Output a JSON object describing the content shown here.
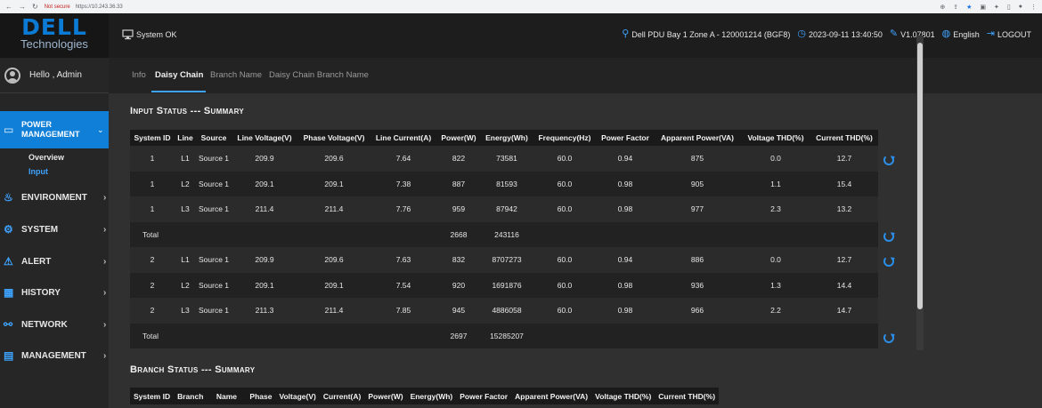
{
  "browser": {
    "secure_label": "Not secure",
    "url": "https://10.243.36.33"
  },
  "header": {
    "logo_top": "DELL",
    "logo_bottom": "Technologies",
    "system_status": "System OK",
    "pdu_name": "Dell PDU Bay 1 Zone A - 120001214 (BGF8)",
    "datetime": "2023-09-11 13:40:50",
    "version": "V1.07801",
    "language": "English",
    "logout": "LOGOUT"
  },
  "sidebar": {
    "greeting": "Hello , Admin",
    "active": {
      "label": "POWER MANAGEMENT",
      "sub": [
        "Overview",
        "Input"
      ]
    },
    "items": [
      "ENVIRONMENT",
      "SYSTEM",
      "ALERT",
      "HISTORY",
      "NETWORK",
      "MANAGEMENT"
    ]
  },
  "tabs": [
    "Info",
    "Daisy Chain",
    "Branch Name",
    "Daisy Chain Branch Name"
  ],
  "input_status": {
    "title": "Input Status --- Summary",
    "columns": [
      "System ID",
      "Line",
      "Source",
      "Line Voltage(V)",
      "Phase Voltage(V)",
      "Line Current(A)",
      "Power(W)",
      "Energy(Wh)",
      "Frequency(Hz)",
      "Power Factor",
      "Apparent Power(VA)",
      "Voltage THD(%)",
      "Current THD(%)"
    ],
    "rows": [
      [
        "1",
        "L1",
        "Source 1",
        "209.9",
        "209.6",
        "7.64",
        "822",
        "73581",
        "60.0",
        "0.94",
        "875",
        "0.0",
        "12.7"
      ],
      [
        "1",
        "L2",
        "Source 1",
        "209.1",
        "209.1",
        "7.38",
        "887",
        "81593",
        "60.0",
        "0.98",
        "905",
        "1.1",
        "15.4"
      ],
      [
        "1",
        "L3",
        "Source 1",
        "211.4",
        "211.4",
        "7.76",
        "959",
        "87942",
        "60.0",
        "0.98",
        "977",
        "2.3",
        "13.2"
      ],
      [
        "Total",
        "",
        "",
        "",
        "",
        "",
        "2668",
        "243116",
        "",
        "",
        "",
        "",
        ""
      ],
      [
        "2",
        "L1",
        "Source 1",
        "209.9",
        "209.6",
        "7.63",
        "832",
        "8707273",
        "60.0",
        "0.94",
        "886",
        "0.0",
        "12.7"
      ],
      [
        "2",
        "L2",
        "Source 1",
        "209.1",
        "209.1",
        "7.54",
        "920",
        "1691876",
        "60.0",
        "0.98",
        "936",
        "1.3",
        "14.4"
      ],
      [
        "2",
        "L3",
        "Source 1",
        "211.3",
        "211.4",
        "7.85",
        "945",
        "4886058",
        "60.0",
        "0.98",
        "966",
        "2.2",
        "14.7"
      ],
      [
        "Total",
        "",
        "",
        "",
        "",
        "",
        "2697",
        "15285207",
        "",
        "",
        "",
        "",
        ""
      ]
    ]
  },
  "branch_status": {
    "title": "Branch Status --- Summary",
    "columns": [
      "System ID",
      "Branch",
      "Name",
      "Phase",
      "Voltage(V)",
      "Current(A)",
      "Power(W)",
      "Energy(Wh)",
      "Power Factor",
      "Apparent Power(VA)",
      "Voltage THD(%)",
      "Current THD(%)"
    ]
  },
  "colors": {
    "accent": "#0f7fd8",
    "icon": "#3ea3ff"
  }
}
